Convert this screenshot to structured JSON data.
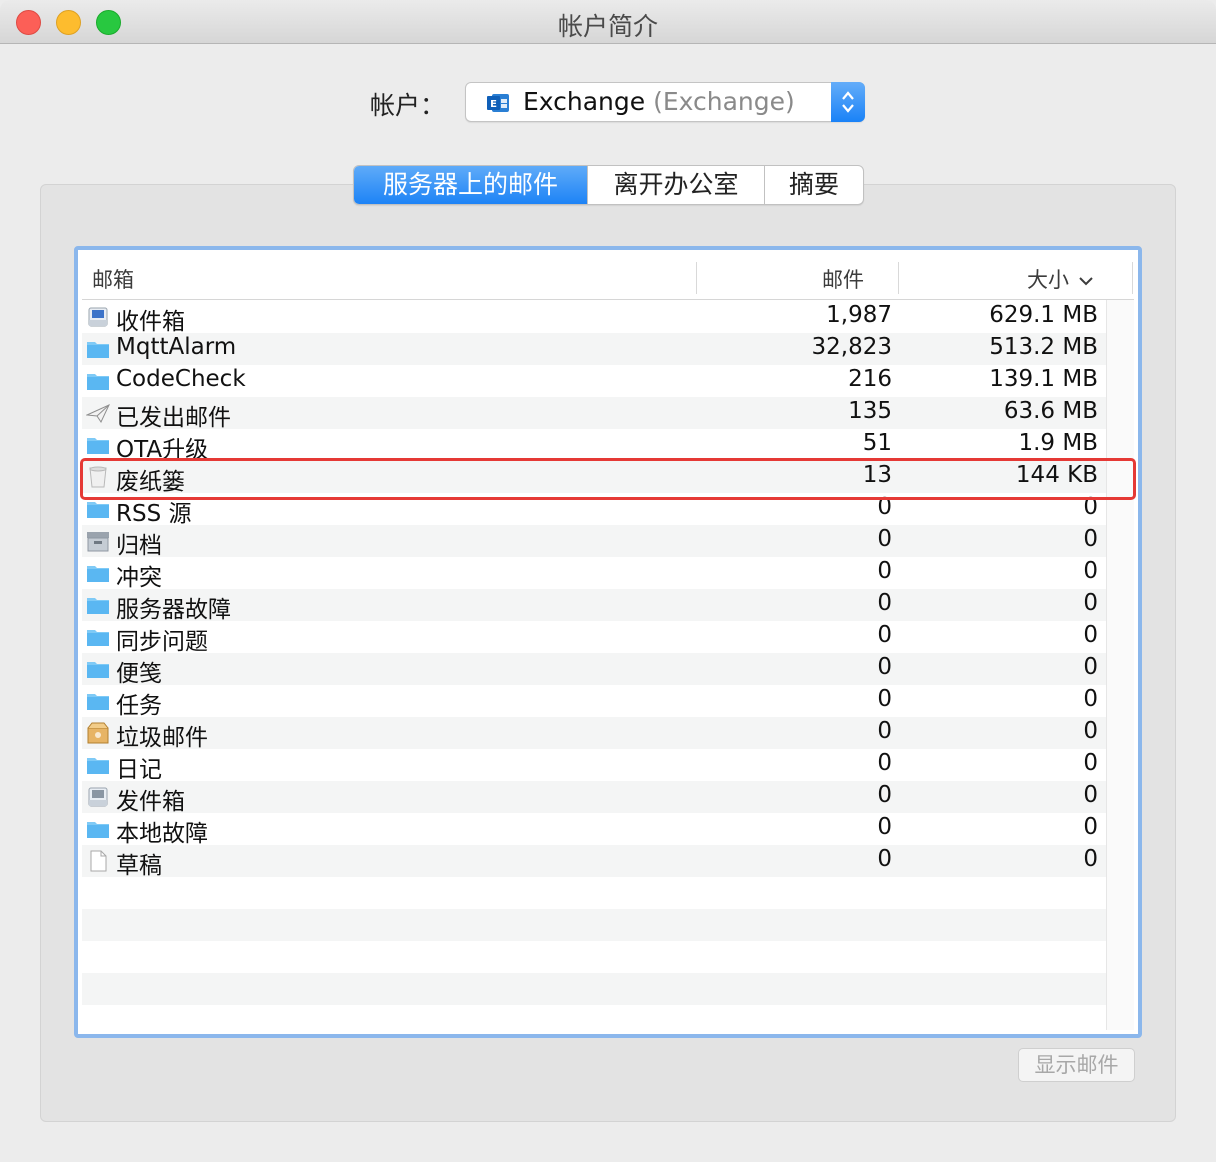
{
  "window": {
    "title": "帐户简介"
  },
  "account": {
    "label": "帐户：",
    "name": "Exchange",
    "type": "(Exchange)",
    "icon": "outlook-exchange-icon"
  },
  "tabs": [
    {
      "label": "服务器上的邮件",
      "active": true
    },
    {
      "label": "离开办公室",
      "active": false
    },
    {
      "label": "摘要",
      "active": false
    }
  ],
  "table": {
    "columns": {
      "mailbox": "邮箱",
      "count": "邮件",
      "size": "大小"
    },
    "sort_column": "size",
    "rows": [
      {
        "icon": "inbox-icon",
        "name": "收件箱",
        "count": "1,987",
        "size": "629.1 MB"
      },
      {
        "icon": "folder-icon",
        "name": "MqttAlarm",
        "count": "32,823",
        "size": "513.2 MB"
      },
      {
        "icon": "folder-icon",
        "name": "CodeCheck",
        "count": "216",
        "size": "139.1 MB"
      },
      {
        "icon": "sent-icon",
        "name": "已发出邮件",
        "count": "135",
        "size": "63.6 MB"
      },
      {
        "icon": "folder-icon",
        "name": "OTA升级",
        "count": "51",
        "size": "1.9 MB"
      },
      {
        "icon": "trash-icon",
        "name": "废纸篓",
        "count": "13",
        "size": "144 KB"
      },
      {
        "icon": "folder-icon",
        "name": "RSS 源",
        "count": "0",
        "size": "0"
      },
      {
        "icon": "archive-icon",
        "name": "归档",
        "count": "0",
        "size": "0"
      },
      {
        "icon": "folder-icon",
        "name": "冲突",
        "count": "0",
        "size": "0"
      },
      {
        "icon": "folder-icon",
        "name": "服务器故障",
        "count": "0",
        "size": "0"
      },
      {
        "icon": "folder-icon",
        "name": "同步问题",
        "count": "0",
        "size": "0"
      },
      {
        "icon": "folder-icon",
        "name": "便笺",
        "count": "0",
        "size": "0"
      },
      {
        "icon": "folder-icon",
        "name": "任务",
        "count": "0",
        "size": "0"
      },
      {
        "icon": "junk-icon",
        "name": "垃圾邮件",
        "count": "0",
        "size": "0"
      },
      {
        "icon": "folder-icon",
        "name": "日记",
        "count": "0",
        "size": "0"
      },
      {
        "icon": "outbox-icon",
        "name": "发件箱",
        "count": "0",
        "size": "0"
      },
      {
        "icon": "folder-icon",
        "name": "本地故障",
        "count": "0",
        "size": "0"
      },
      {
        "icon": "drafts-icon",
        "name": "草稿",
        "count": "0",
        "size": "0"
      }
    ],
    "highlighted_row": "废纸篓"
  },
  "footer": {
    "show_button_label": "显示邮件"
  },
  "colors": {
    "accent": "#1d83f6",
    "highlight_border": "#e53935",
    "folder": "#5ab7f2"
  }
}
